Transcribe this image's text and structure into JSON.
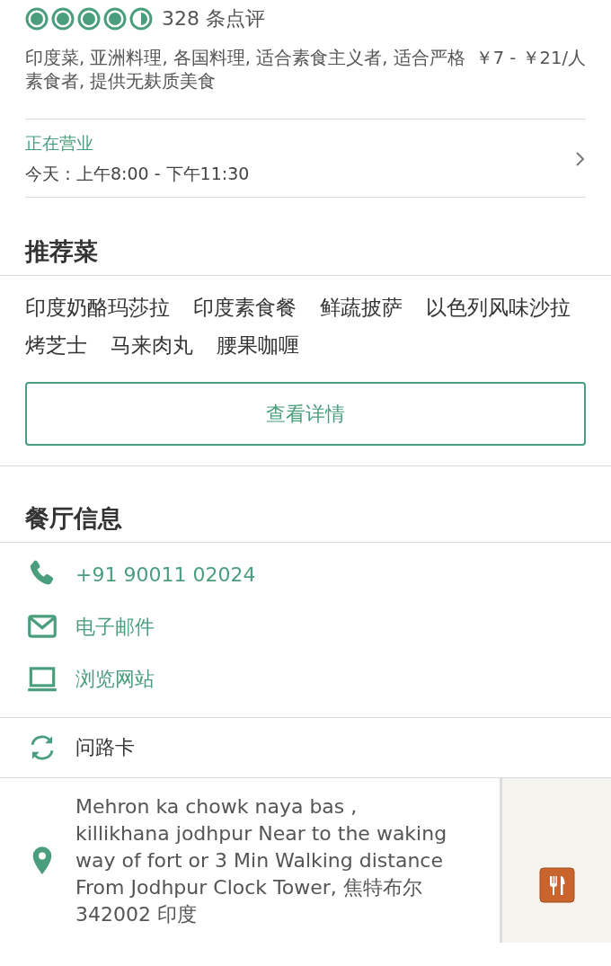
{
  "rating": {
    "stars": 4.5,
    "reviews": "328 条点评"
  },
  "cuisines": "印度菜, 亚洲料理, 各国料理, 适合素食主义者, 适合严格素食者, 提供无麸质美食",
  "price": "￥7 - ￥21/人",
  "hours": {
    "status": "正在营业",
    "today": "今天：上午8:00 - 下午11:30"
  },
  "recommended": {
    "title": "推荐菜",
    "dishes": [
      "印度奶酪玛莎拉",
      "印度素食餐",
      "鲜蔬披萨",
      "以色列风味沙拉",
      "烤芝士",
      "马来肉丸",
      "腰果咖喱"
    ],
    "button": "查看详情"
  },
  "info": {
    "title": "餐厅信息",
    "contacts": [
      {
        "kind": "phone",
        "label": "+91 90011 02024"
      },
      {
        "kind": "email",
        "label": "电子邮件"
      },
      {
        "kind": "website",
        "label": "浏览网站"
      }
    ],
    "direction_card": "问路卡",
    "address": "Mehron ka chowk naya bas , killikhana jodhpur Near to the waking way of fort or 3 Min Walking distance From Jodhpur Clock Tower, 焦特布尔 342002 印度"
  }
}
